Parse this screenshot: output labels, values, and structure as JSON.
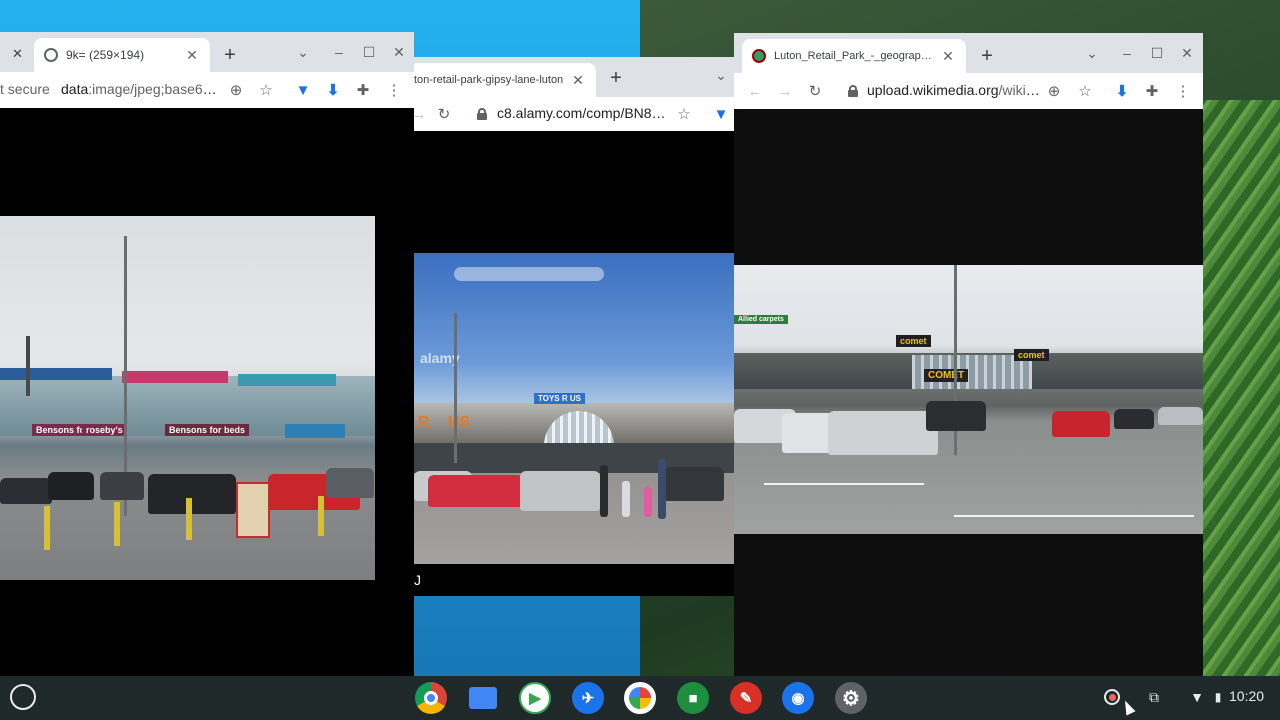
{
  "windows": [
    {
      "tab_title": "9k= (259×194)",
      "prev_tab_close": "✕",
      "security_label": "t secure",
      "url_scheme": "data",
      "url_rest": ":image/jpeg;base64,...",
      "photo_caption_signs": [
        "Bensons for beds",
        "roseby's",
        "Bensons for beds"
      ]
    },
    {
      "tab_title": "ton-retail-park-gipsy-lane-luton",
      "url": "c8.alamy.com/comp/BN8K...",
      "watermark": "alamy",
      "photo_signs": [
        "TOYS R US",
        "R",
        "US"
      ],
      "partial_text": "J"
    },
    {
      "tab_title": "Luton_Retail_Park_-_geograph.o",
      "url_host": "upload.wikimedia.org",
      "url_rest": "/wikip...",
      "photo_signs": [
        "comet",
        "COMET",
        "comet",
        "Allied carpets"
      ]
    }
  ],
  "shelf": {
    "apps": [
      "chrome-icon",
      "files-icon",
      "meet-icon",
      "play-icon",
      "photos-icon",
      "chat-icon",
      "canvas-icon",
      "camera-icon",
      "settings-icon"
    ],
    "clock": "10:20"
  },
  "colors": {
    "accent": "#1a73e8",
    "tabstrip": "#dee1e6",
    "shelf": "#202421"
  }
}
